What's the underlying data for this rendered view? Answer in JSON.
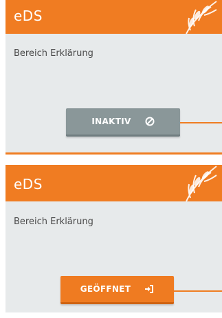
{
  "cards": [
    {
      "title": "eDS",
      "description": "Bereich Erklärung",
      "status_label": "INAKTIV",
      "status_icon": "ban-icon",
      "status_color": "#8a9799"
    },
    {
      "title": "eDS",
      "description": "Bereich Erklärung",
      "status_label": "GEÖFFNET",
      "status_icon": "sign-in-icon",
      "status_color": "#ef7b21"
    }
  ],
  "colors": {
    "accent": "#f07c22",
    "card_background": "#e7eaeb"
  }
}
